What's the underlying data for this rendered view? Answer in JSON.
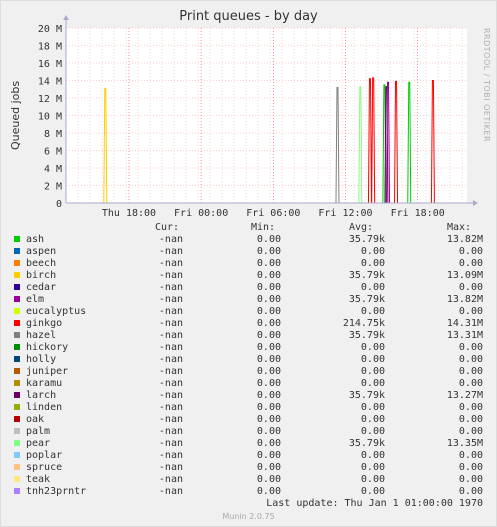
{
  "chart_data": {
    "type": "line",
    "title": "Print queues - by day",
    "ylabel": "Queued jobs",
    "ylim": [
      0,
      20
    ],
    "y_unit": "M",
    "y_ticks": [
      "0",
      "2 M",
      "4 M",
      "6 M",
      "8 M",
      "10 M",
      "12 M",
      "14 M",
      "16 M",
      "18 M",
      "20 M"
    ],
    "x_ticks": [
      "Thu 18:00",
      "Fri 00:00",
      "Fri 06:00",
      "Fri 12:00",
      "Fri 18:00"
    ],
    "grid": true,
    "spikes": [
      {
        "series": "birch",
        "x": 0.098,
        "y": 13.1
      },
      {
        "series": "hazel",
        "x": 0.677,
        "y": 13.2
      },
      {
        "series": "pear",
        "x": 0.734,
        "y": 13.3
      },
      {
        "series": "ginkgo",
        "x": 0.758,
        "y": 14.2
      },
      {
        "series": "ginkgo",
        "x": 0.766,
        "y": 14.3
      },
      {
        "series": "ash",
        "x": 0.794,
        "y": 13.5
      },
      {
        "series": "larch",
        "x": 0.799,
        "y": 13.3
      },
      {
        "series": "elm",
        "x": 0.803,
        "y": 13.8
      },
      {
        "series": "ginkgo",
        "x": 0.823,
        "y": 13.9
      },
      {
        "series": "ash",
        "x": 0.856,
        "y": 13.8
      },
      {
        "series": "ginkgo",
        "x": 0.915,
        "y": 14.0
      }
    ],
    "series": [
      {
        "name": "ash",
        "color": "#00cc00",
        "cur": "-nan",
        "min": "0.00",
        "avg": "35.79k",
        "max": "13.82M"
      },
      {
        "name": "aspen",
        "color": "#0066b3",
        "cur": "-nan",
        "min": "0.00",
        "avg": "0.00",
        "max": "0.00"
      },
      {
        "name": "beech",
        "color": "#ff8000",
        "cur": "-nan",
        "min": "0.00",
        "avg": "0.00",
        "max": "0.00"
      },
      {
        "name": "birch",
        "color": "#ffcc00",
        "cur": "-nan",
        "min": "0.00",
        "avg": "35.79k",
        "max": "13.09M"
      },
      {
        "name": "cedar",
        "color": "#330099",
        "cur": "-nan",
        "min": "0.00",
        "avg": "0.00",
        "max": "0.00"
      },
      {
        "name": "elm",
        "color": "#990099",
        "cur": "-nan",
        "min": "0.00",
        "avg": "35.79k",
        "max": "13.82M"
      },
      {
        "name": "eucalyptus",
        "color": "#ccff00",
        "cur": "-nan",
        "min": "0.00",
        "avg": "0.00",
        "max": "0.00"
      },
      {
        "name": "ginkgo",
        "color": "#ff0000",
        "cur": "-nan",
        "min": "0.00",
        "avg": "214.75k",
        "max": "14.31M"
      },
      {
        "name": "hazel",
        "color": "#808080",
        "cur": "-nan",
        "min": "0.00",
        "avg": "35.79k",
        "max": "13.31M"
      },
      {
        "name": "hickory",
        "color": "#008f00",
        "cur": "-nan",
        "min": "0.00",
        "avg": "0.00",
        "max": "0.00"
      },
      {
        "name": "holly",
        "color": "#00487d",
        "cur": "-nan",
        "min": "0.00",
        "avg": "0.00",
        "max": "0.00"
      },
      {
        "name": "juniper",
        "color": "#b35a00",
        "cur": "-nan",
        "min": "0.00",
        "avg": "0.00",
        "max": "0.00"
      },
      {
        "name": "karamu",
        "color": "#b38f00",
        "cur": "-nan",
        "min": "0.00",
        "avg": "0.00",
        "max": "0.00"
      },
      {
        "name": "larch",
        "color": "#6b006b",
        "cur": "-nan",
        "min": "0.00",
        "avg": "35.79k",
        "max": "13.27M"
      },
      {
        "name": "linden",
        "color": "#8fb300",
        "cur": "-nan",
        "min": "0.00",
        "avg": "0.00",
        "max": "0.00"
      },
      {
        "name": "oak",
        "color": "#b30000",
        "cur": "-nan",
        "min": "0.00",
        "avg": "0.00",
        "max": "0.00"
      },
      {
        "name": "palm",
        "color": "#bebebe",
        "cur": "-nan",
        "min": "0.00",
        "avg": "0.00",
        "max": "0.00"
      },
      {
        "name": "pear",
        "color": "#80ff80",
        "cur": "-nan",
        "min": "0.00",
        "avg": "35.79k",
        "max": "13.35M"
      },
      {
        "name": "poplar",
        "color": "#80c9ff",
        "cur": "-nan",
        "min": "0.00",
        "avg": "0.00",
        "max": "0.00"
      },
      {
        "name": "spruce",
        "color": "#ffc080",
        "cur": "-nan",
        "min": "0.00",
        "avg": "0.00",
        "max": "0.00"
      },
      {
        "name": "teak",
        "color": "#ffe680",
        "cur": "-nan",
        "min": "0.00",
        "avg": "0.00",
        "max": "0.00"
      },
      {
        "name": "tnh23prntr",
        "color": "#aa80ff",
        "cur": "-nan",
        "min": "0.00",
        "avg": "0.00",
        "max": "0.00"
      }
    ]
  },
  "legend_headers": {
    "cur": "Cur:",
    "min": "Min:",
    "avg": "Avg:",
    "max": "Max:"
  },
  "last_update": "Last update: Thu Jan  1 01:00:00 1970",
  "footer": "Munin 2.0.75",
  "watermark": "RRDTOOL / TOBI OETIKER"
}
